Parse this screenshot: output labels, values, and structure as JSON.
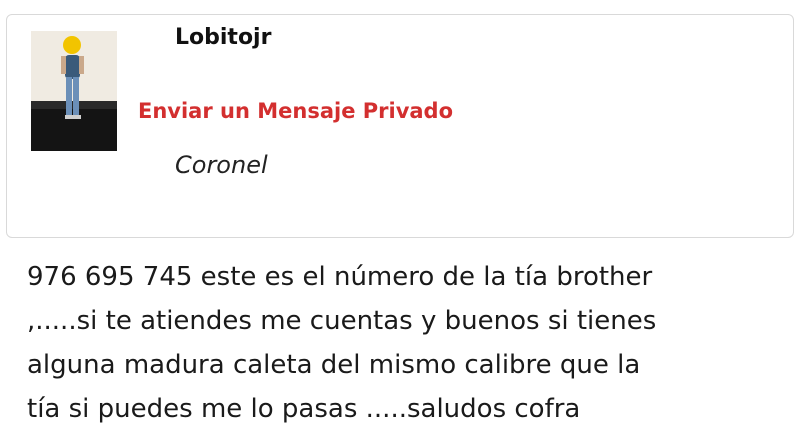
{
  "profile": {
    "username": "Lobitojr",
    "private_message_label": "Enviar un Mensaje Privado",
    "rank": "Coronel",
    "avatar_icon": "user-photo-avatar"
  },
  "post": {
    "lines": [
      "976 695 745 este es el número de la tía brother",
      ",.....si te atiendes me cuentas y buenos si tienes",
      "alguna madura caleta del mismo calibre que la",
      "tía si puedes me lo pasas .....saludos cofra"
    ]
  },
  "colors": {
    "link_red": "#d32f2f",
    "card_border": "#d9d9d9",
    "text": "#1a1a1a"
  }
}
